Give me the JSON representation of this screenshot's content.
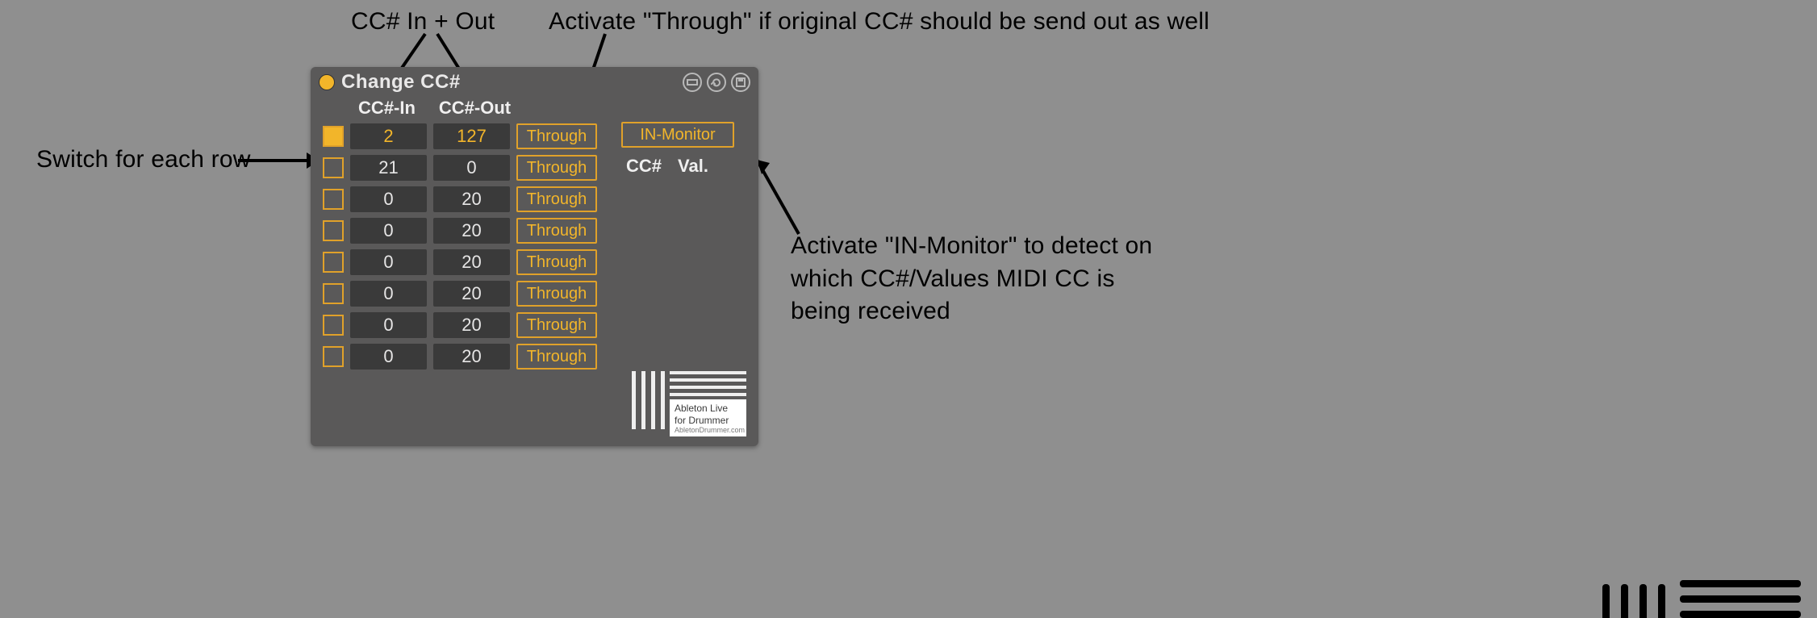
{
  "annotations": {
    "cc_in_out": "CC# In + Out",
    "through": "Activate \"Through\" if original CC# should be send out as well",
    "switch_row": "Switch for each row",
    "in_monitor": "Activate \"IN-Monitor\" to detect on which CC#/Values MIDI CC is being received"
  },
  "device": {
    "title": "Change CC#",
    "headers": {
      "cc_in": "CC#-In",
      "cc_out": "CC#-Out"
    },
    "through_label": "Through",
    "rows": [
      {
        "active": true,
        "cc_in": "2",
        "cc_out": "127"
      },
      {
        "active": false,
        "cc_in": "21",
        "cc_out": "0"
      },
      {
        "active": false,
        "cc_in": "0",
        "cc_out": "20"
      },
      {
        "active": false,
        "cc_in": "0",
        "cc_out": "20"
      },
      {
        "active": false,
        "cc_in": "0",
        "cc_out": "20"
      },
      {
        "active": false,
        "cc_in": "0",
        "cc_out": "20"
      },
      {
        "active": false,
        "cc_in": "0",
        "cc_out": "20"
      },
      {
        "active": false,
        "cc_in": "0",
        "cc_out": "20"
      }
    ],
    "monitor": {
      "button": "IN-Monitor",
      "cc_label": "CC#",
      "val_label": "Val."
    },
    "logo": {
      "line1": "Ableton Live",
      "line2": "for Drummer",
      "line3": "AbletonDrummer.com"
    }
  }
}
